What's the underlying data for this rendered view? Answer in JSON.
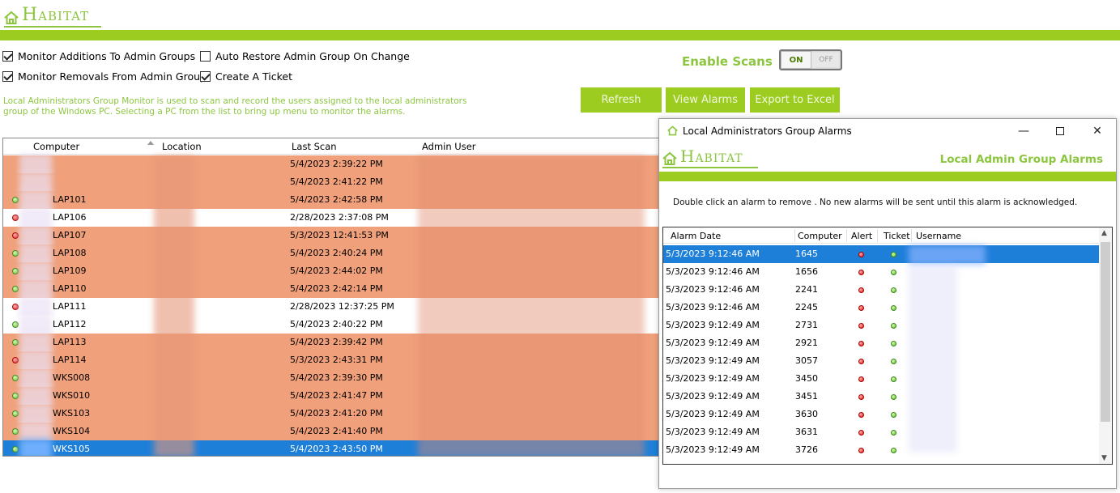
{
  "brand": {
    "name": "Habitat",
    "accent": "#8cc63f",
    "bar": "#9ccc1f"
  },
  "options": {
    "monitor_additions": {
      "label": "Monitor Additions To Admin Groups",
      "checked": true
    },
    "monitor_removals": {
      "label": "Monitor Removals From Admin Group",
      "checked": true
    },
    "auto_restore": {
      "label": "Auto Restore Admin Group On Change",
      "checked": false
    },
    "create_ticket": {
      "label": "Create A Ticket",
      "checked": true
    }
  },
  "scans": {
    "label": "Enable Scans",
    "on": "ON",
    "off": "OFF",
    "state": "on"
  },
  "description": "Local Administrators Group Monitor is used to scan and record the users assigned to the local administrators group of the Windows PC. Selecting a PC from the list to bring up menu to monitor the alarms.",
  "buttons": {
    "refresh": "Refresh",
    "view_alarms": "View Alarms",
    "export": "Export to Excel"
  },
  "grid": {
    "columns": {
      "computer": "Computer",
      "location": "Location",
      "last_scan": "Last Scan",
      "admin_user": "Admin User"
    },
    "rows": [
      {
        "status": "none",
        "computer": "",
        "scan": "5/4/2023 2:39:22 PM",
        "style": "orange"
      },
      {
        "status": "none",
        "computer": "",
        "scan": "5/4/2023 2:41:22 PM",
        "style": "orange"
      },
      {
        "status": "green",
        "computer": "LAP101",
        "scan": "5/4/2023 2:42:58 PM",
        "style": "orange"
      },
      {
        "status": "red",
        "computer": "LAP106",
        "scan": "2/28/2023 2:37:08 PM",
        "style": "white"
      },
      {
        "status": "red",
        "computer": "LAP107",
        "scan": "5/3/2023 12:41:53 PM",
        "style": "orange"
      },
      {
        "status": "green",
        "computer": "LAP108",
        "scan": "5/4/2023 2:40:24 PM",
        "style": "orange"
      },
      {
        "status": "green",
        "computer": "LAP109",
        "scan": "5/4/2023 2:44:02 PM",
        "style": "orange"
      },
      {
        "status": "green",
        "computer": "LAP110",
        "scan": "5/4/2023 2:42:14 PM",
        "style": "orange"
      },
      {
        "status": "red",
        "computer": "LAP111",
        "scan": "2/28/2023 12:37:25 PM",
        "style": "white"
      },
      {
        "status": "green",
        "computer": "LAP112",
        "scan": "5/4/2023 2:40:22 PM",
        "style": "white"
      },
      {
        "status": "green",
        "computer": "LAP113",
        "scan": "5/4/2023 2:39:42 PM",
        "style": "orange"
      },
      {
        "status": "red",
        "computer": "LAP114",
        "scan": "5/3/2023 2:43:31 PM",
        "style": "orange"
      },
      {
        "status": "green",
        "computer": "WKS008",
        "scan": "5/4/2023 2:39:30 PM",
        "style": "orange"
      },
      {
        "status": "green",
        "computer": "WKS010",
        "scan": "5/4/2023 2:41:47 PM",
        "style": "orange"
      },
      {
        "status": "green",
        "computer": "WKS103",
        "scan": "5/4/2023 2:41:20 PM",
        "style": "orange"
      },
      {
        "status": "green",
        "computer": "WKS104",
        "scan": "5/4/2023 2:41:40 PM",
        "style": "orange"
      },
      {
        "status": "green",
        "computer": "WKS105",
        "scan": "5/4/2023 2:43:50 PM",
        "style": "sel"
      }
    ]
  },
  "alarm_window": {
    "title": "Local Administrators Group Alarms",
    "subtitle": "Local Admin Group Alarms",
    "note": "Double click an alarm to remove . No new alarms will be sent until this alarm is acknowledged.",
    "columns": {
      "date": "Alarm Date",
      "computer": "Computer",
      "alert": "Alert",
      "ticket": "Ticket",
      "username": "Username"
    },
    "rows": [
      {
        "date": "5/3/2023 9:12:46 AM",
        "computer": "1645",
        "selected": true
      },
      {
        "date": "5/3/2023 9:12:46 AM",
        "computer": "1656",
        "selected": false
      },
      {
        "date": "5/3/2023 9:12:46 AM",
        "computer": "2241",
        "selected": false
      },
      {
        "date": "5/3/2023 9:12:46 AM",
        "computer": "2245",
        "selected": false
      },
      {
        "date": "5/3/2023 9:12:49 AM",
        "computer": "2731",
        "selected": false
      },
      {
        "date": "5/3/2023 9:12:49 AM",
        "computer": "2921",
        "selected": false
      },
      {
        "date": "5/3/2023 9:12:49 AM",
        "computer": "3057",
        "selected": false
      },
      {
        "date": "5/3/2023 9:12:49 AM",
        "computer": "3450",
        "selected": false
      },
      {
        "date": "5/3/2023 9:12:49 AM",
        "computer": "3451",
        "selected": false
      },
      {
        "date": "5/3/2023 9:12:49 AM",
        "computer": "3630",
        "selected": false
      },
      {
        "date": "5/3/2023 9:12:49 AM",
        "computer": "3631",
        "selected": false
      },
      {
        "date": "5/3/2023 9:12:49 AM",
        "computer": "3726",
        "selected": false
      }
    ]
  }
}
